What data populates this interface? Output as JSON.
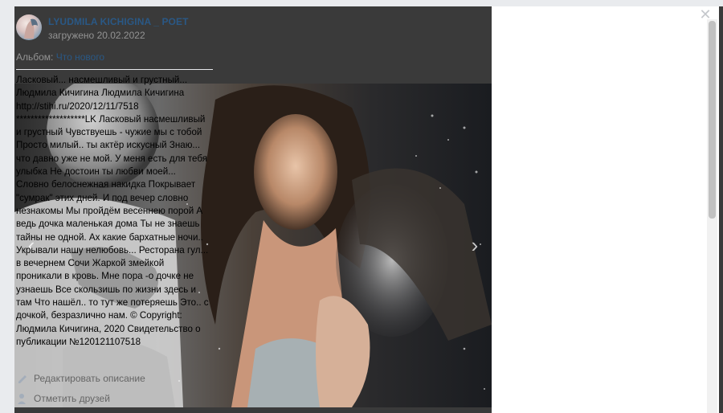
{
  "author": {
    "name": "LYUDMILA KICHIGINA _ POET",
    "uploaded": "загружено 20.02.2022"
  },
  "album": {
    "label": "Альбом:",
    "name": "Что нового"
  },
  "description": [
    "Ласковый... насмешливый и грустный...",
    "Людмила Кичигина Людмила Кичигина",
    "http://stihi.ru/2020/12/11/7518",
    "*******************LK Ласковый насмешливый и грустный Чувствуешь - чужие мы с тобой Просто милый.. ты актёр искусный Знаю... что давно уже не мой. У меня есть для тебя улыбка Не достоин ты любви моей... Словно белоснежная накидка Покрывает \"сумрак\" этих дней. И под вечер словно незнакомы Мы пройдём весеннею порой А ведь дочка маленькая дома Ты не знаешь тайны не одной. Ах какие бархатные ночи.. Укрывали нашу нелюбовь... Ресторана гул... в вечернем Сочи Жаркой змейкой проникали в кровь. Мне пора -о дочке не узнаешь Все скользишь по жизни здесь и там Что нашёл.. то тут же потеряешь Это.. с дочкой, безразлично нам. © Copyright: Людмила Кичигина, 2020 Свидетельство о публикации №120121107518"
  ],
  "actions": {
    "edit": "Редактировать описание",
    "tag": "Отметить друзей"
  },
  "icons": {
    "prev": "chevron-left-icon",
    "next": "chevron-right-icon",
    "close": "close-icon",
    "edit": "pencil-icon",
    "tag": "person-tag-icon"
  },
  "colors": {
    "link": "#2a5885",
    "muted": "#939393",
    "backdrop": "#3a3a3a"
  }
}
